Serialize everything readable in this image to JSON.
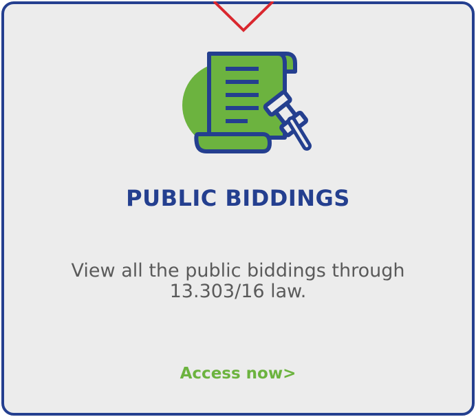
{
  "card": {
    "title": "PUBLIC BIDDINGS",
    "description": "View all the public biddings through 13.303/16 law.",
    "cta_label": "Access now>",
    "icon": "scroll-gavel-icon"
  },
  "colors": {
    "primary_blue": "#243f8f",
    "accent_green": "#6cb33f",
    "background": "#ececec",
    "notch_red": "#d9272e",
    "body_text": "#5a5a5a"
  }
}
